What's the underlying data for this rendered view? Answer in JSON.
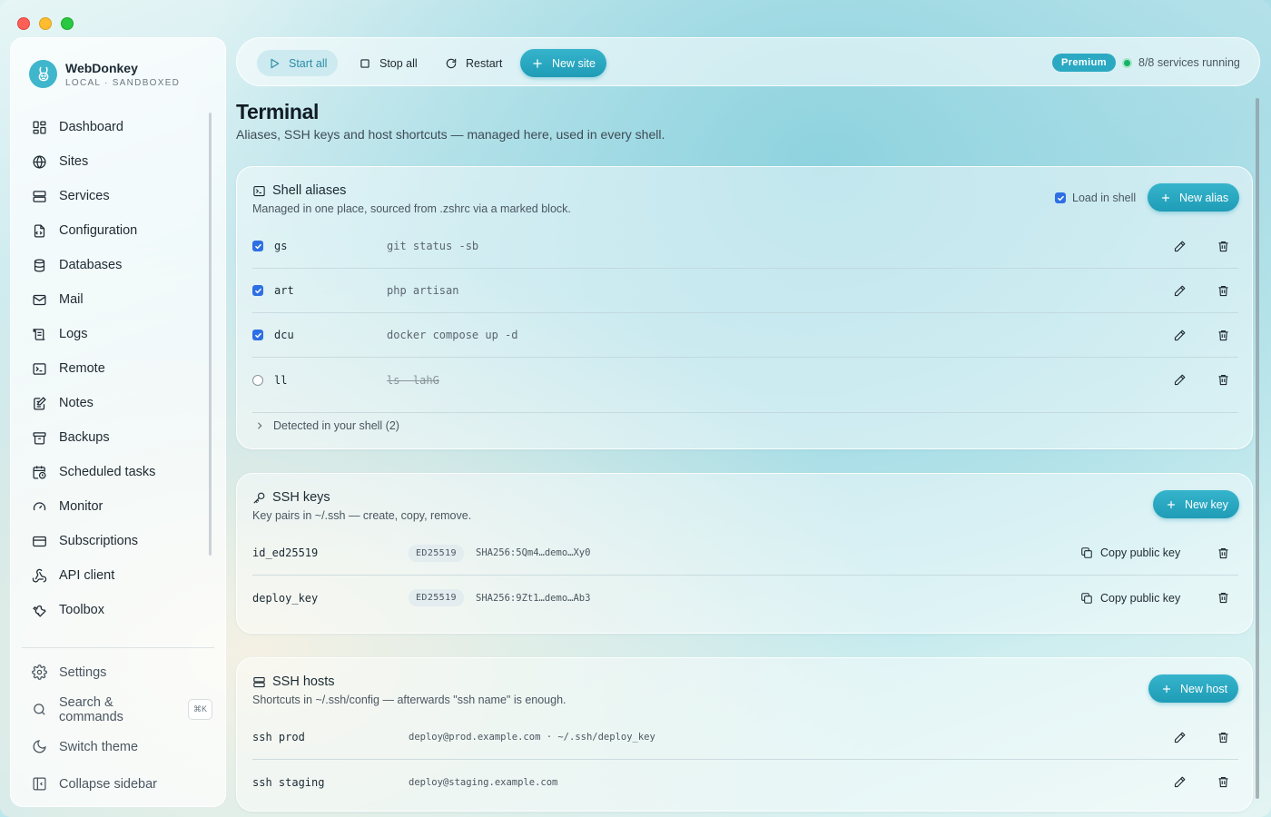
{
  "window": {
    "title": "WebDonkey"
  },
  "brand": {
    "name": "WebDonkey",
    "subtitle": "LOCAL · SANDBOXED"
  },
  "sidebar": {
    "items": [
      {
        "label": "Dashboard",
        "icon": "dashboard-icon"
      },
      {
        "label": "Sites",
        "icon": "globe-icon"
      },
      {
        "label": "Services",
        "icon": "server-icon"
      },
      {
        "label": "Configuration",
        "icon": "config-file-icon"
      },
      {
        "label": "Databases",
        "icon": "database-icon"
      },
      {
        "label": "Mail",
        "icon": "mail-icon"
      },
      {
        "label": "Logs",
        "icon": "logs-icon"
      },
      {
        "label": "Remote",
        "icon": "terminal-icon"
      },
      {
        "label": "Notes",
        "icon": "notes-icon"
      },
      {
        "label": "Backups",
        "icon": "archive-icon"
      },
      {
        "label": "Scheduled tasks",
        "icon": "calendar-clock-icon"
      },
      {
        "label": "Monitor",
        "icon": "gauge-icon"
      },
      {
        "label": "Subscriptions",
        "icon": "credit-card-icon"
      },
      {
        "label": "API client",
        "icon": "webhook-icon"
      },
      {
        "label": "Toolbox",
        "icon": "wrench-icon"
      }
    ],
    "bottom": {
      "settings": "Settings",
      "search": "Search & commands",
      "search_shortcut": "⌘K",
      "theme": "Switch theme",
      "collapse": "Collapse sidebar"
    }
  },
  "toolbar": {
    "start_all": "Start all",
    "stop_all": "Stop all",
    "restart": "Restart",
    "new_site": "New site",
    "badge": "Premium",
    "status": "8/8 services running"
  },
  "page": {
    "title": "Terminal",
    "subtitle": "Aliases, SSH keys and host shortcuts — managed here, used in every shell."
  },
  "aliases": {
    "title": "Shell aliases",
    "description": "Managed in one place, sourced from .zshrc via a marked block.",
    "load_in_shell": "Load in shell",
    "load_in_shell_checked": true,
    "new_button": "New alias",
    "rows": [
      {
        "name": "gs",
        "command": "git status -sb",
        "enabled": true
      },
      {
        "name": "art",
        "command": "php artisan",
        "enabled": true
      },
      {
        "name": "dcu",
        "command": "docker compose up -d",
        "enabled": true
      },
      {
        "name": "ll",
        "command": "ls -lahG",
        "enabled": false
      }
    ],
    "detected": "Detected in your shell (2)"
  },
  "ssh_keys": {
    "title": "SSH keys",
    "description": "Key pairs in ~/.ssh — create, copy, remove.",
    "new_button": "New key",
    "copy_label": "Copy public key",
    "rows": [
      {
        "name": "id_ed25519",
        "type": "ED25519",
        "fingerprint": "SHA256:5Qm4…demo…Xy0"
      },
      {
        "name": "deploy_key",
        "type": "ED25519",
        "fingerprint": "SHA256:9Zt1…demo…Ab3"
      }
    ]
  },
  "ssh_hosts": {
    "title": "SSH hosts",
    "description": "Shortcuts in ~/.ssh/config — afterwards \"ssh name\" is enough.",
    "new_button": "New host",
    "rows": [
      {
        "name": "ssh prod",
        "target": "deploy@prod.example.com · ~/.ssh/deploy_key"
      },
      {
        "name": "ssh staging",
        "target": "deploy@staging.example.com"
      }
    ]
  },
  "colors": {
    "accent": "#1f9cb6",
    "checkbox": "#2f6fe4",
    "status_ok": "#17b26a"
  }
}
